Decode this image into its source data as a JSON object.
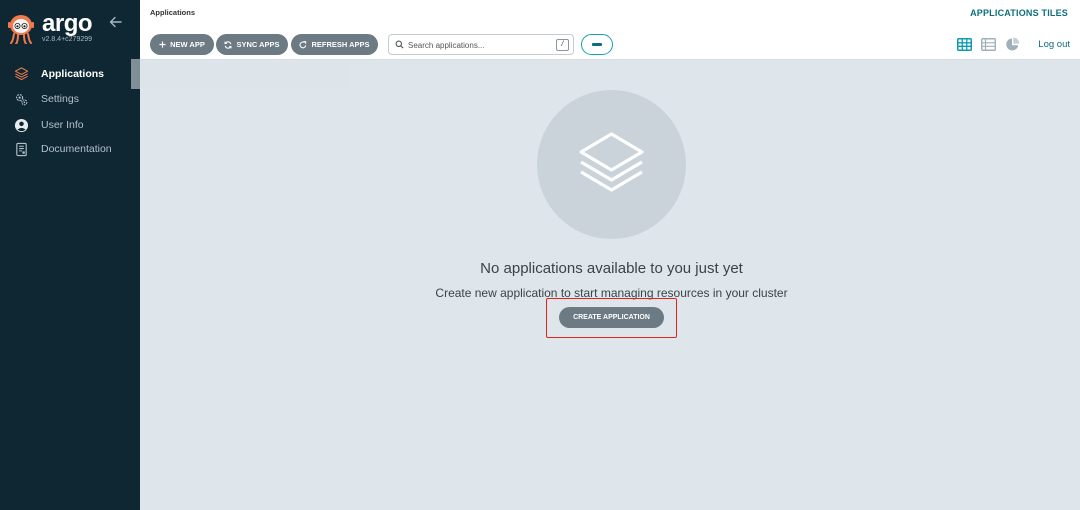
{
  "brand": {
    "name": "argo",
    "version": "v2.8.4+c279299"
  },
  "sidebar": {
    "items": [
      {
        "label": "Applications",
        "icon": "layers-icon",
        "active": true
      },
      {
        "label": "Settings",
        "icon": "gears-icon",
        "active": false
      },
      {
        "label": "User Info",
        "icon": "user-circle-icon",
        "active": false
      },
      {
        "label": "Documentation",
        "icon": "docs-icon",
        "active": false
      }
    ]
  },
  "topbar": {
    "breadcrumb": "Applications",
    "page_title": "APPLICATIONS TILES",
    "buttons": {
      "new_app": "NEW APP",
      "sync_apps": "SYNC APPS",
      "refresh_apps": "REFRESH APPS"
    },
    "search": {
      "placeholder": "Search applications...",
      "value": "",
      "shortcut": "/"
    },
    "logout": "Log out"
  },
  "empty_state": {
    "title": "No applications available to you just yet",
    "subtitle": "Create new application to start managing resources in your cluster",
    "button": "CREATE APPLICATION"
  },
  "colors": {
    "sidebar_bg": "#0f2733",
    "accent": "#0d6e7f",
    "button_bg": "#6c7a83",
    "page_bg": "#dee6eb",
    "highlight_box": "#e0241a",
    "logo_orange": "#ef7b4d"
  }
}
